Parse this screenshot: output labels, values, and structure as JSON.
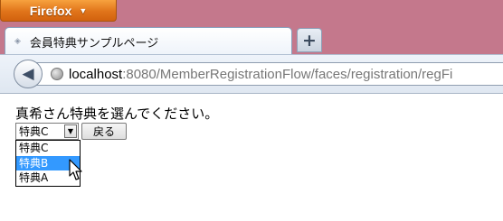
{
  "browser": {
    "app_button_label": "Firefox",
    "tab_title": "会員特典サンプルページ",
    "new_tab_label": "+",
    "url_host": "localhost",
    "url_rest": ":8080/MemberRegistrationFlow/faces/registration/regFi"
  },
  "page": {
    "heading": "真希さん特典を選んでください。",
    "select_value": "特典C",
    "back_button_label": "戻る",
    "dropdown_options": [
      {
        "label": "特典C",
        "highlighted": false
      },
      {
        "label": "特典B",
        "highlighted": true
      },
      {
        "label": "特典A",
        "highlighted": false
      }
    ]
  },
  "colors": {
    "highlight": "#3399ff",
    "firefox_orange": "#e0741a",
    "window_frame": "#c4788c"
  }
}
